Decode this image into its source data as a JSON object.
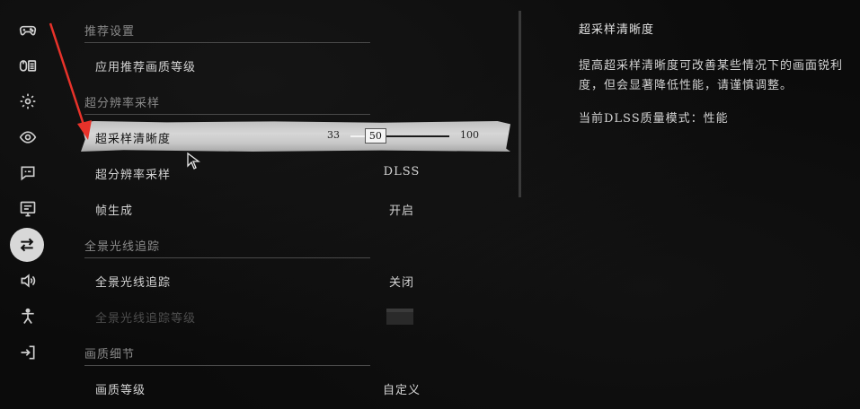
{
  "sidebar": {
    "items": [
      {
        "icon": "gamepad-icon"
      },
      {
        "icon": "keyboard-mouse-icon"
      },
      {
        "icon": "gear-icon"
      },
      {
        "icon": "eye-icon"
      },
      {
        "icon": "subtitles-icon"
      },
      {
        "icon": "display-icon"
      },
      {
        "icon": "graphics-sliders-icon",
        "active": true
      },
      {
        "icon": "audio-icon"
      },
      {
        "icon": "accessibility-icon"
      },
      {
        "icon": "exit-icon"
      }
    ]
  },
  "sections": {
    "recommended": "推荐设置",
    "super_resolution": "超分辨率采样",
    "path_tracing": "全景光线追踪",
    "quality_details": "画质细节"
  },
  "rows": {
    "apply_recommended": {
      "label": "应用推荐画质等级"
    },
    "sharpness": {
      "label": "超采样清晰度",
      "min": "33",
      "value": "50",
      "max": "100"
    },
    "upscaling": {
      "label": "超分辨率采样",
      "value": "DLSS"
    },
    "frame_gen": {
      "label": "帧生成",
      "value": "开启"
    },
    "path_tracing": {
      "label": "全景光线追踪",
      "value": "关闭"
    },
    "path_tracing_level": {
      "label": "全景光线追踪等级"
    },
    "quality_level": {
      "label": "画质等级",
      "value": "自定义"
    }
  },
  "detail": {
    "title": "超采样清晰度",
    "description": "提高超采样清晰度可改善某些情况下的画面锐利度，但会显著降低性能，请谨慎调整。",
    "mode": "当前DLSS质量模式：性能"
  },
  "colors": {
    "background": "#0b0b0b",
    "highlight": "#d0d0d0",
    "annotation_arrow": "#e8322a"
  }
}
